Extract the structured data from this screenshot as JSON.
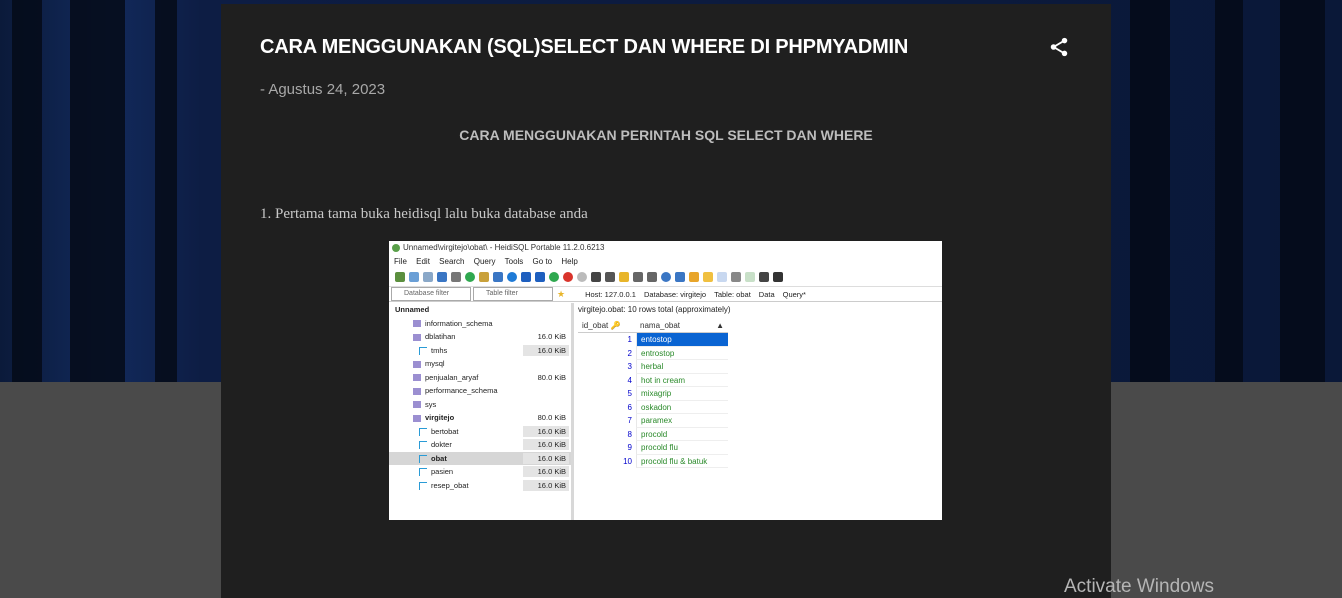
{
  "post": {
    "title": "CARA MENGGUNAKAN (SQL)SELECT DAN WHERE DI PHPMYADMIN",
    "date": "- Agustus 24, 2023",
    "subtitle": "CARA MENGGUNAKAN PERINTAH SQL SELECT DAN WHERE",
    "paragraph": "1. Pertama tama buka heidisql lalu buka database anda",
    "share_icon": "share-icon"
  },
  "screenshot": {
    "window_title": "Unnamed\\virgitejo\\obat\\ - HeidiSQL Portable 11.2.0.6213",
    "menu": [
      "File",
      "Edit",
      "Search",
      "Query",
      "Tools",
      "Go to",
      "Help"
    ],
    "db_filter": "Database filter",
    "table_filter": "Table filter",
    "tabs": [
      "Host: 127.0.0.1",
      "Database: virgitejo",
      "Table: obat",
      "Data",
      "Query*"
    ],
    "tree": [
      {
        "name": "Unnamed",
        "size": "",
        "type": "root"
      },
      {
        "name": "information_schema",
        "size": "",
        "type": "db"
      },
      {
        "name": "dblatihan",
        "size": "16.0 KiB",
        "type": "db"
      },
      {
        "name": "tmhs",
        "size": "16.0 KiB",
        "type": "table"
      },
      {
        "name": "mysql",
        "size": "",
        "type": "db"
      },
      {
        "name": "penjualan_aryaf",
        "size": "80.0 KiB",
        "type": "db"
      },
      {
        "name": "performance_schema",
        "size": "",
        "type": "db"
      },
      {
        "name": "sys",
        "size": "",
        "type": "db"
      },
      {
        "name": "virgitejo",
        "size": "80.0 KiB",
        "type": "db"
      },
      {
        "name": "bertobat",
        "size": "16.0 KiB",
        "type": "table"
      },
      {
        "name": "dokter",
        "size": "16.0 KiB",
        "type": "table"
      },
      {
        "name": "obat",
        "size": "16.0 KiB",
        "type": "table",
        "selected": true
      },
      {
        "name": "pasien",
        "size": "16.0 KiB",
        "type": "table"
      },
      {
        "name": "resep_obat",
        "size": "16.0 KiB",
        "type": "table"
      }
    ],
    "grid_caption": "virgitejo.obat: 10 rows total (approximately)",
    "columns": [
      "id_obat",
      "nama_obat"
    ],
    "rows": [
      {
        "id": "1",
        "nama": "entostop"
      },
      {
        "id": "2",
        "nama": "entrostop"
      },
      {
        "id": "3",
        "nama": "herbal"
      },
      {
        "id": "4",
        "nama": "hot in cream"
      },
      {
        "id": "5",
        "nama": "mixagrip"
      },
      {
        "id": "6",
        "nama": "oskadon"
      },
      {
        "id": "7",
        "nama": "paramex"
      },
      {
        "id": "8",
        "nama": "procold"
      },
      {
        "id": "9",
        "nama": "procold flu"
      },
      {
        "id": "10",
        "nama": "procold flu & batuk"
      }
    ]
  },
  "watermark": "Activate Windows"
}
